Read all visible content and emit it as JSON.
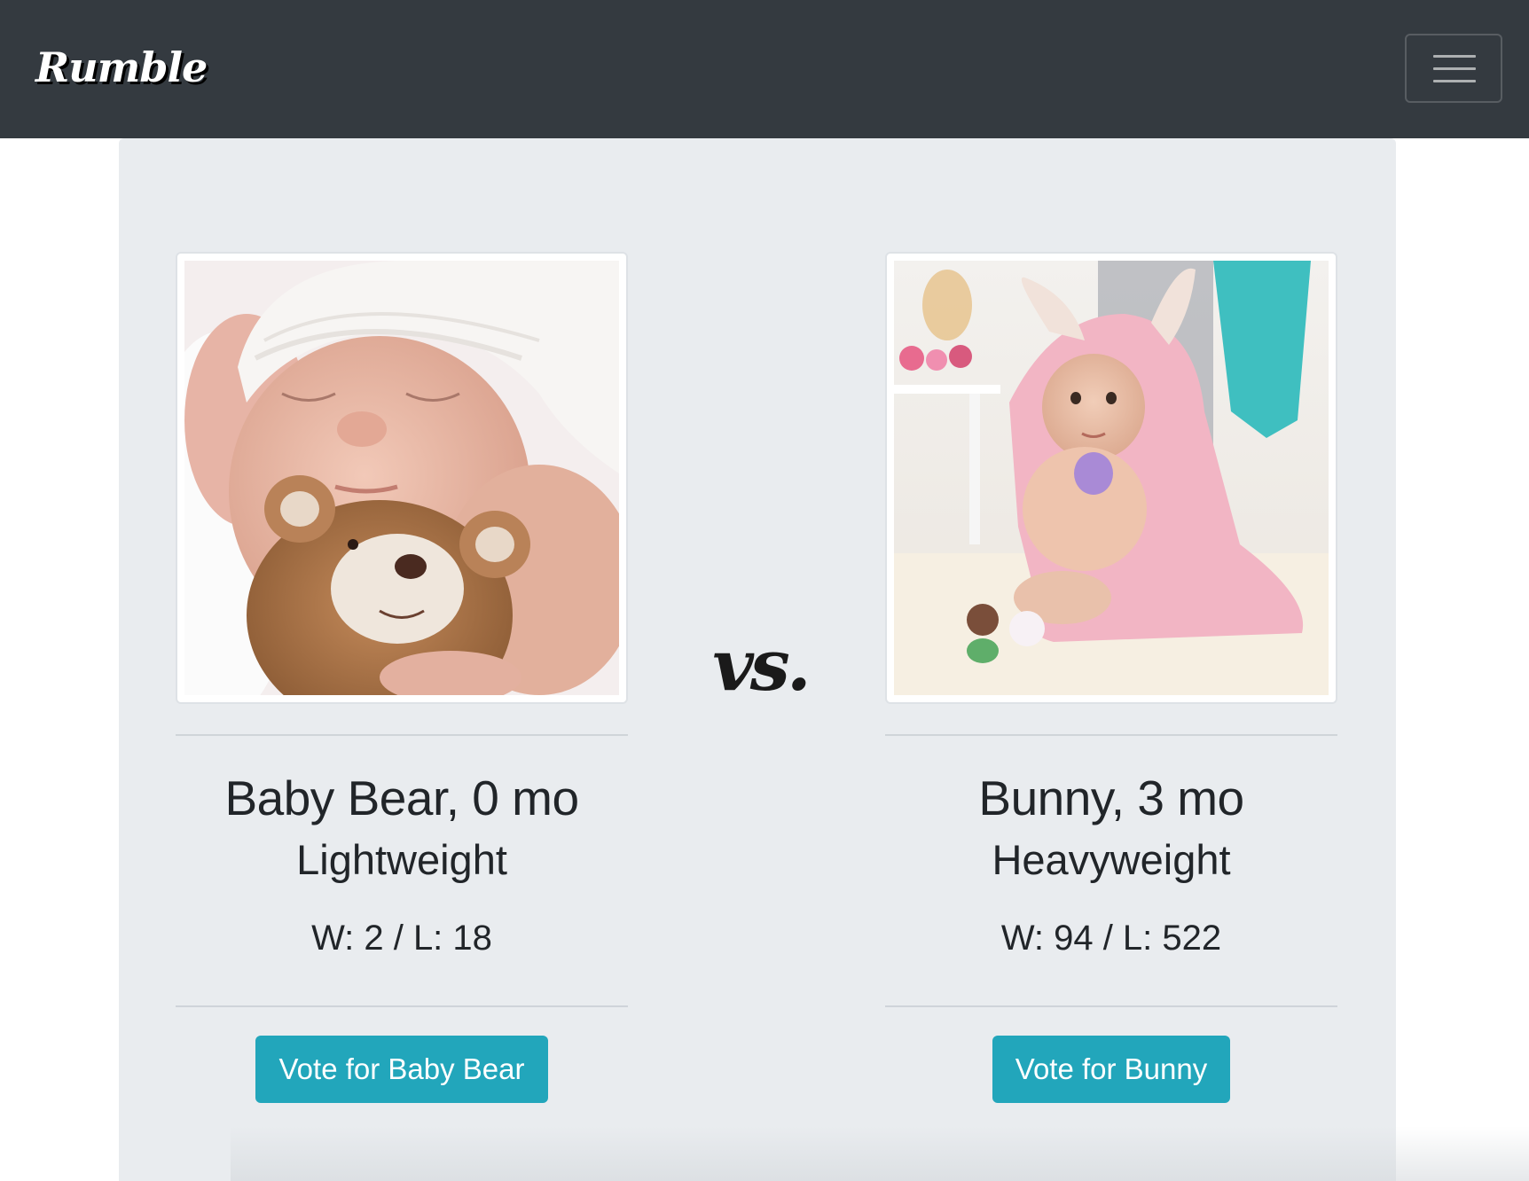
{
  "navbar": {
    "brand": "Rumble",
    "toggler_icon": "hamburger-menu-icon"
  },
  "matchup": {
    "versus_text": "vs."
  },
  "contenders": [
    {
      "photo_subject": "sleeping newborn in white knit hat holding brown teddy bear",
      "name_line": "Baby Bear, 0 mo",
      "weight_class": "Lightweight",
      "record": "W: 2 / L: 18",
      "vote_label": "Vote for Baby Bear"
    },
    {
      "photo_subject": "baby in pink bunny-ear hooded towel holding a toy",
      "name_line": "Bunny, 3 mo",
      "weight_class": "Heavyweight",
      "record": "W: 94 / L: 522",
      "vote_label": "Vote for Bunny"
    }
  ],
  "colors": {
    "navbar_bg": "#343a40",
    "jumbotron_bg": "#e9ecef",
    "button_bg": "#22a6bb",
    "text": "#212529"
  }
}
